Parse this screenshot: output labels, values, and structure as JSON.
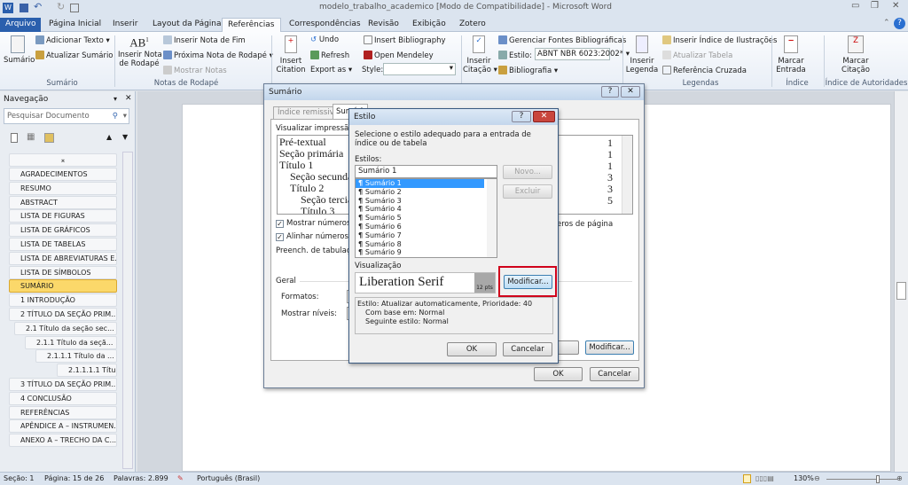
{
  "window": {
    "title": "modelo_trabalho_academico [Modo de Compatibilidade]  -  Microsoft Word"
  },
  "tabs": [
    "Arquivo",
    "Página Inicial",
    "Inserir",
    "Layout da Página",
    "Referências",
    "Correspondências",
    "Revisão",
    "Exibição",
    "Zotero"
  ],
  "ribbon": {
    "sumario": {
      "big": "Sumário",
      "add": "Adicionar Texto",
      "update": "Atualizar Sumário",
      "group": "Sumário"
    },
    "notas": {
      "big1": "Inserir Nota",
      "big2": "de Rodapé",
      "end": "Inserir Nota de Fim",
      "next": "Próxima Nota de Rodapé",
      "show": "Mostrar Notas",
      "group": "Notas de Rodapé"
    },
    "mendeley": {
      "big1": "Insert",
      "big2": "Citation",
      "undo": "Undo",
      "refresh": "Refresh",
      "export": "Export as",
      "biblio": "Insert Bibliography",
      "open": "Open Mendeley",
      "style": "Style:"
    },
    "citacoes": {
      "big1": "Inserir",
      "big2": "Citação",
      "manage": "Gerenciar Fontes Bibliográficas",
      "style_label": "Estilo:",
      "style_value": "ABNT NBR 6023:2002*",
      "biblio": "Bibliografia"
    },
    "legendas": {
      "big1": "Inserir",
      "big2": "Legenda",
      "ilus": "Inserir Índice de Ilustrações",
      "upd": "Atualizar Tabela",
      "cross": "Referência Cruzada",
      "group": "Legendas"
    },
    "indice": {
      "big1": "Marcar",
      "big2": "Entrada",
      "group": "Índice"
    },
    "autoridades": {
      "big1": "Marcar",
      "big2": "Citação",
      "group": "Índice de Autoridades"
    }
  },
  "nav": {
    "title": "Navegação",
    "search_placeholder": "Pesquisar Documento",
    "items": [
      "AGRADECIMENTOS",
      "RESUMO",
      "ABSTRACT",
      "LISTA DE FIGURAS",
      "LISTA DE GRÁFICOS",
      "LISTA DE TABELAS",
      "LISTA DE ABREVIATURAS E...",
      "LISTA DE SÍMBOLOS",
      "SUMÁRIO",
      "1 INTRODUÇÃO",
      "2 TÍTULO DA SEÇÃO PRIM...",
      "2.1 Título da seção sec...",
      "2.1.1 Título da seçã...",
      "2.1.1.1 Título da ...",
      "2.1.1.1.1 Títul...",
      "3 TÍTULO DA SEÇÃO PRIM...",
      "4 CONCLUSÃO",
      "REFERÊNCIAS",
      "APÊNDICE A – INSTRUMEN...",
      "ANEXO A – TRECHO DA C..."
    ],
    "selected": "SUMÁRIO"
  },
  "sumario_dialog": {
    "title": "Sumário",
    "tabs": [
      "Índice remissivo",
      "Sumário"
    ],
    "preview_label": "Visualizar impressão",
    "preview": [
      "Pré-textual",
      "Seção primária",
      "Título 1",
      "Seção secundá",
      "Título 2",
      "Seção terciá",
      "Título 3"
    ],
    "page_numbers": [
      "1",
      "1",
      "1",
      "3",
      "3",
      "5"
    ],
    "show_numbers": "Mostrar números de",
    "align_numbers": "Alinhar números de",
    "hyperlinks_tail": "eros de página",
    "tab_leader": "Preench. de tabulação:",
    "general": "Geral",
    "formats": "Formatos:",
    "levels": "Mostrar níveis:",
    "options": "...",
    "modify": "Modificar...",
    "ok": "OK",
    "cancel": "Cancelar"
  },
  "estilo_dialog": {
    "title": "Estilo",
    "instruction": "Selecione o estilo adequado para a entrada de índice ou de tabela",
    "styles_label": "Estilos:",
    "style_value": "Sumário 1",
    "styles": [
      "Sumário 1",
      "Sumário 2",
      "Sumário 3",
      "Sumário 4",
      "Sumário 5",
      "Sumário 6",
      "Sumário 7",
      "Sumário 8",
      "Sumário 9"
    ],
    "new": "Novo...",
    "delete": "Excluir",
    "preview_label": "Visualização",
    "preview_font": "Liberation Serif",
    "preview_size": "12 pts",
    "modify": "Modificar...",
    "desc1": "Estilo: Atualizar automaticamente, Prioridade: 40",
    "desc2": "Com base em: Normal",
    "desc3": "Seguinte estilo: Normal",
    "ok": "OK",
    "cancel": "Cancelar",
    "highlight_color": "#d0021b"
  },
  "status": {
    "section": "Seção: 1",
    "page": "Página: 15 de 26",
    "words": "Palavras: 2.899",
    "language": "Português (Brasil)",
    "zoom": "130%"
  },
  "colors": {
    "file_tab": "#2a5fad",
    "selected_nav": "#fbd86a",
    "accent_red": "#d0021b"
  }
}
